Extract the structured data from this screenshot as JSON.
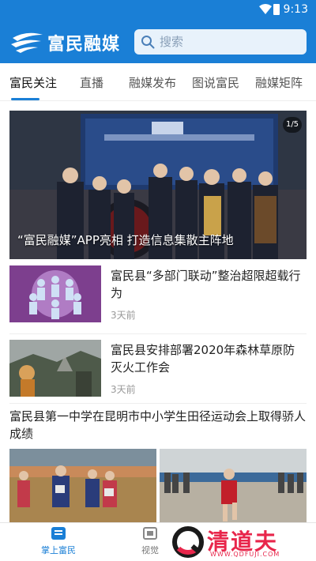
{
  "status_bar": {
    "time": "9:13"
  },
  "app": {
    "title": "富民融媒"
  },
  "search": {
    "placeholder": "搜索"
  },
  "tabs": [
    {
      "label": "富民关注"
    },
    {
      "label": "直播"
    },
    {
      "label": "融媒发布"
    },
    {
      "label": "图说富民"
    },
    {
      "label": "融媒矩阵"
    }
  ],
  "banner": {
    "counter": "1/5",
    "caption": "“富民融媒”APP亮相 打造信息集散主阵地"
  },
  "news": [
    {
      "title": "富民县“多部门联动”整治超限超载行为",
      "time": "3天前"
    },
    {
      "title": "富民县安排部署2020年森林草原防灭火工作会",
      "time": "3天前"
    },
    {
      "title": "富民县第一中学在昆明市中小学生田径运动会上取得骄人成绩"
    }
  ],
  "bottom_nav": [
    {
      "label": "掌上富民"
    },
    {
      "label": "视觉"
    }
  ],
  "watermark": {
    "name": "清道夫",
    "url": "WWW.QDFUJI.COM"
  },
  "colors": {
    "brand": "#1a7fd6",
    "watermark": "#e8264b"
  }
}
